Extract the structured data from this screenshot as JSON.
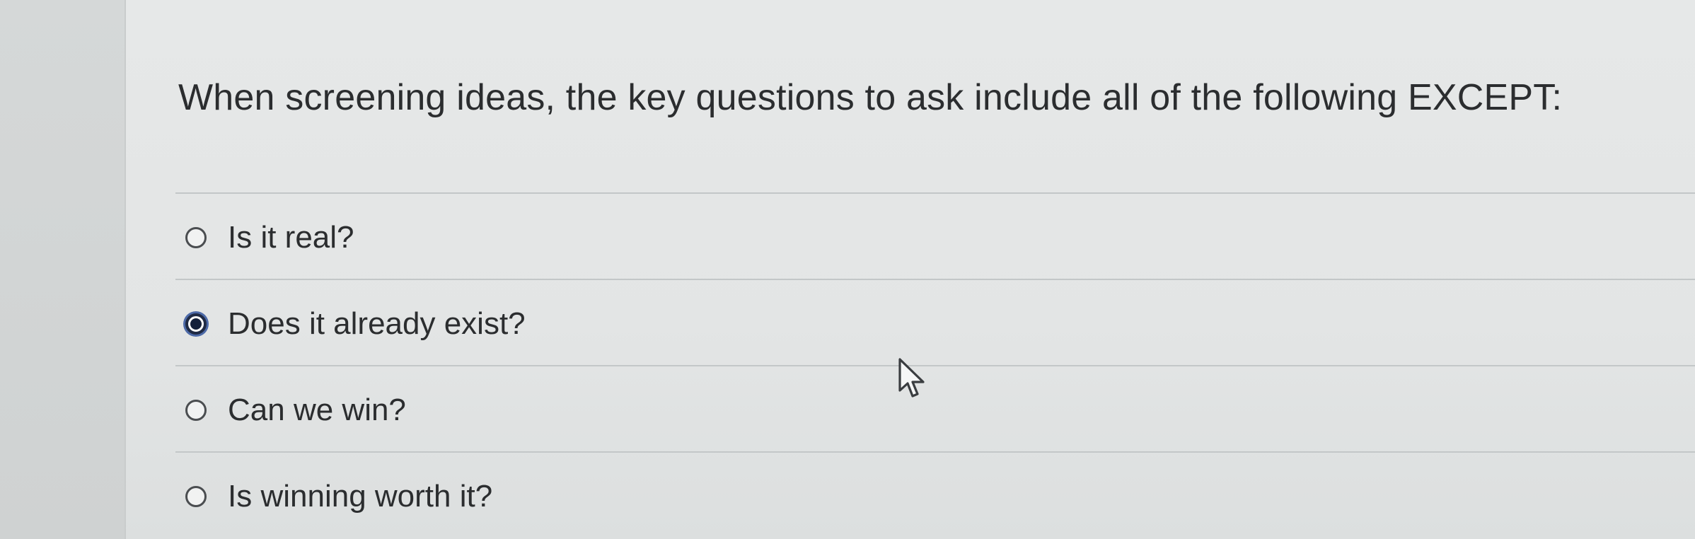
{
  "question": {
    "text": "When screening ideas, the key questions to ask include all of the following EXCEPT:"
  },
  "options": [
    {
      "label": "Is it real?",
      "selected": false
    },
    {
      "label": "Does it already exist?",
      "selected": true
    },
    {
      "label": "Can we win?",
      "selected": false
    },
    {
      "label": "Is winning worth it?",
      "selected": false
    }
  ],
  "colors": {
    "text": "#2b2d2f",
    "radio_selected_fill": "#14203a",
    "radio_selected_ring": "#4d6aa8",
    "separator": "#c3c7c8"
  },
  "cursor": {
    "icon": "mouse-pointer-icon"
  }
}
